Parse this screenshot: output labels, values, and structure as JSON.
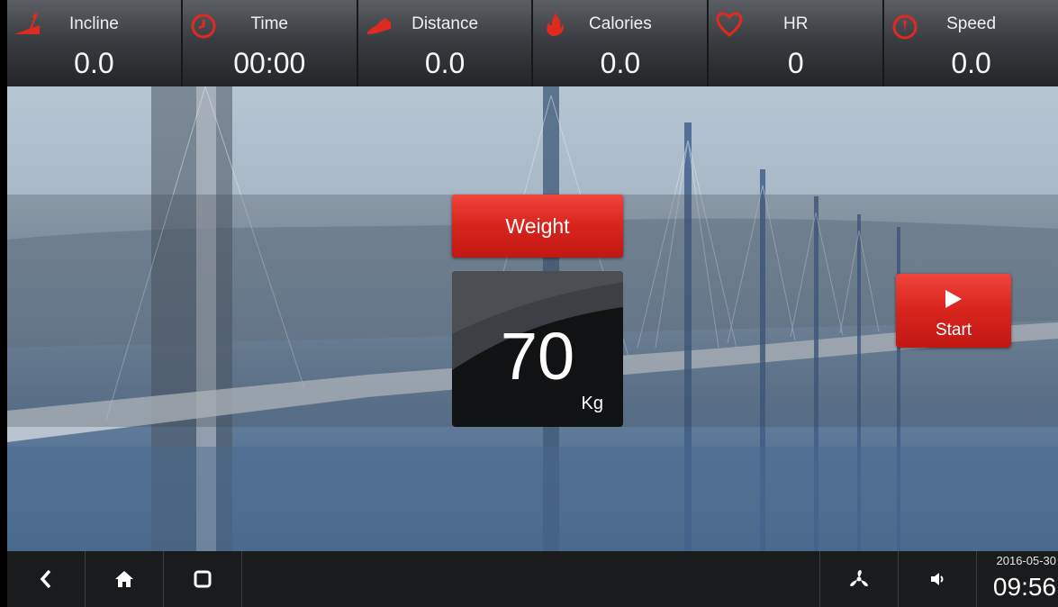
{
  "stats": [
    {
      "label": "Incline",
      "value": "0.0",
      "icon": "incline-icon"
    },
    {
      "label": "Time",
      "value": "00:00",
      "icon": "clock-icon"
    },
    {
      "label": "Distance",
      "value": "0.0",
      "icon": "running-shoe-icon"
    },
    {
      "label": "Calories",
      "value": "0.0",
      "icon": "flame-icon"
    },
    {
      "label": "HR",
      "value": "0",
      "icon": "heart-icon"
    },
    {
      "label": "Speed",
      "value": "0.0",
      "icon": "speedometer-icon"
    }
  ],
  "weight": {
    "label": "Weight",
    "value": "70",
    "unit": "Kg"
  },
  "start": {
    "label": "Start",
    "icon": "play-icon"
  },
  "nav": {
    "buttons": [
      "back-icon",
      "home-icon",
      "recents-icon",
      "fan-icon",
      "volume-icon"
    ],
    "date": "2016-05-30",
    "time": "09:56"
  },
  "colors": {
    "accent": "#d7241d",
    "icon": "#e02a20"
  }
}
